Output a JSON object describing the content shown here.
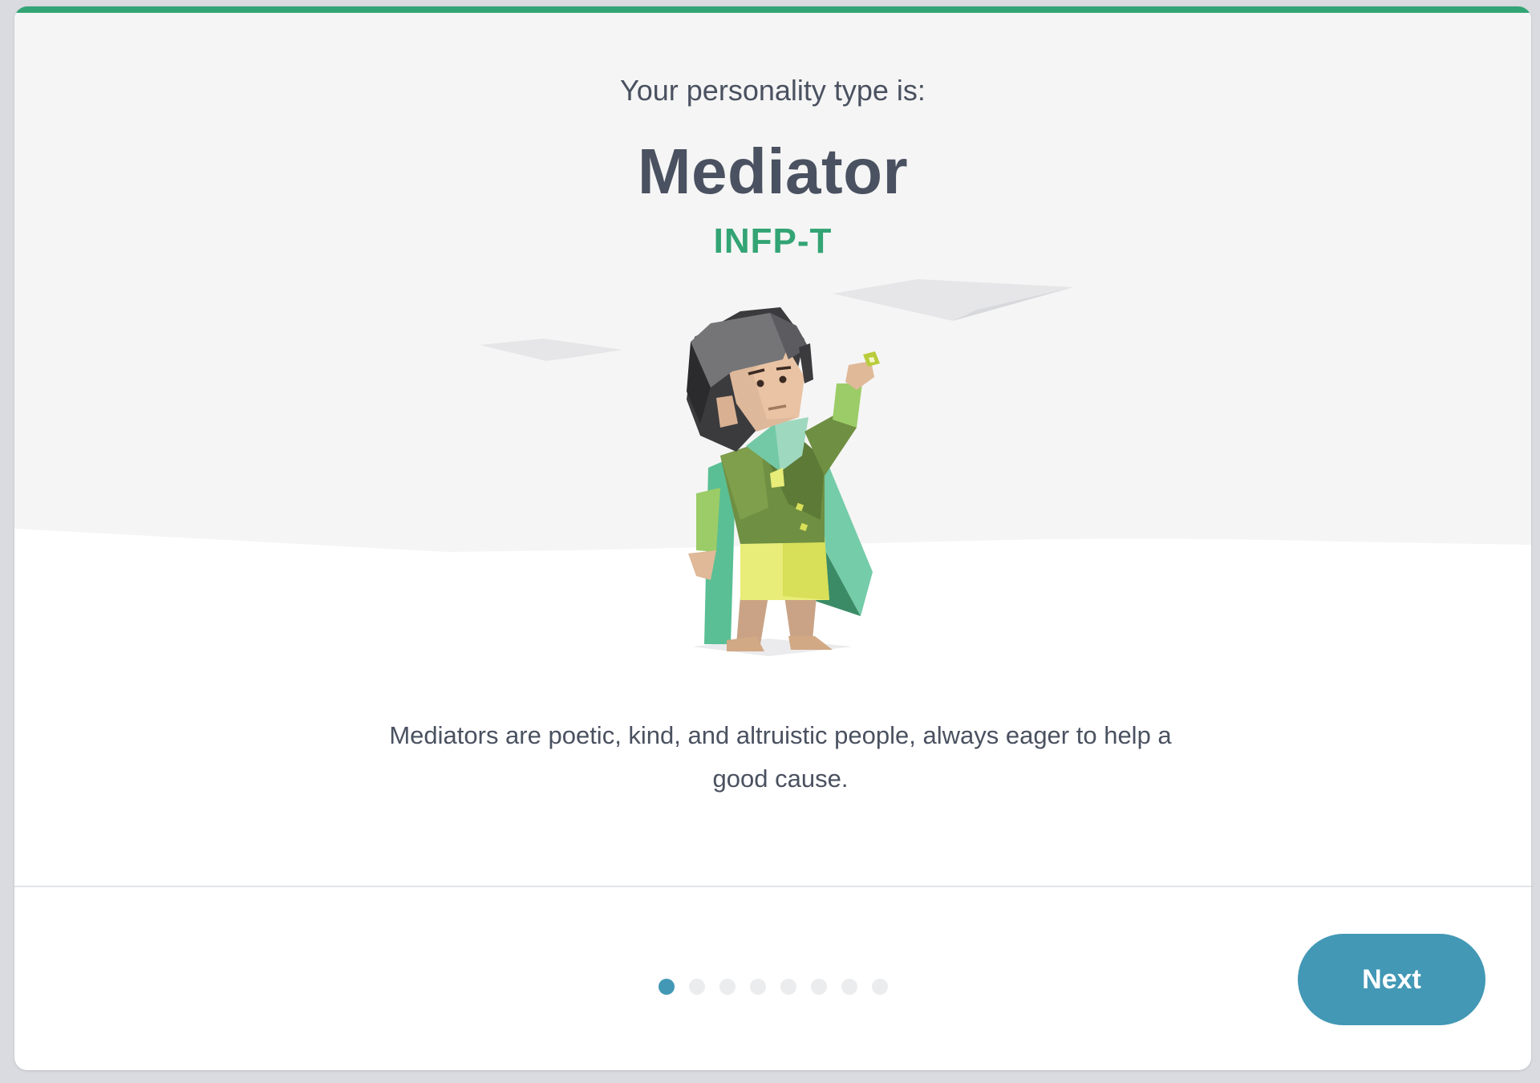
{
  "result": {
    "intro": "Your personality type is:",
    "type_name": "Mediator",
    "type_code": "INFP-T",
    "description": "Mediators are poetic, kind, and altruistic people, always eager to help a good cause."
  },
  "illustration": {
    "icon": "mediator-character-illustration"
  },
  "pagination": {
    "total": 8,
    "current": 1
  },
  "footer": {
    "next_label": "Next"
  },
  "colors": {
    "accent_green": "#33a474",
    "button_blue": "#4298b5",
    "text_dark": "#4a5160",
    "hero_bg": "#f5f5f5"
  }
}
